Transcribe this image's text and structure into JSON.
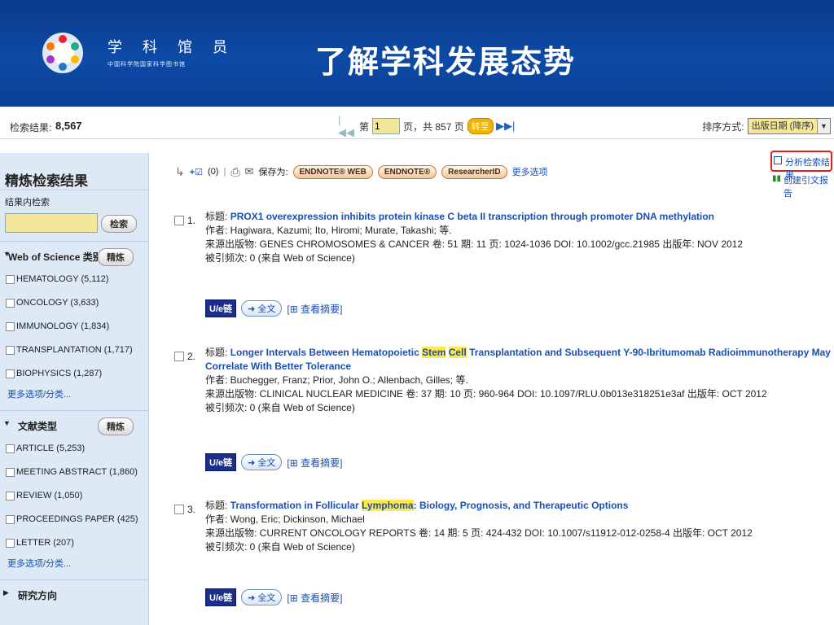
{
  "banner": {
    "brand_title": "学 科 馆 员",
    "brand_sub": "中国科学院国家科学图书馆",
    "slide_title": "了解学科发展态势"
  },
  "topbar": {
    "results_label": "检索结果:",
    "results_count": "8,567",
    "page_prefix": "第",
    "page_value": "1",
    "page_suffix": "页，共 857 页",
    "goto_label": "转至",
    "sort_label": "排序方式:",
    "sort_value": "出版日期 (降序)"
  },
  "sidebar": {
    "title": "精炼检索结果",
    "within_label": "结果内检索",
    "search_button": "检索",
    "refine_button": "精炼",
    "wos_heading": "Web of Science 类别",
    "wos_items": [
      "HEMATOLOGY (5,112)",
      "ONCOLOGY (3,633)",
      "IMMUNOLOGY (1,834)",
      "TRANSPLANTATION (1,717)",
      "BIOPHYSICS (1,287)"
    ],
    "more_label": "更多选项/分类...",
    "doc_heading": "文献类型",
    "doc_items": [
      "ARTICLE (5,253)",
      "MEETING ABSTRACT (1,860)",
      "REVIEW (1,050)",
      "PROCEEDINGS PAPER (425)",
      "LETTER (207)"
    ],
    "dir_heading": "研究方向"
  },
  "toolbar": {
    "marked_count": "(0)",
    "save_label": "保存为:",
    "endnote_web": "ENDNOTE® WEB",
    "endnote": "ENDNOTE®",
    "researcherid": "ResearcherID",
    "more_options": "更多选项",
    "analyze": "分析检索结果",
    "citation_report": "创建引文报告"
  },
  "results": [
    {
      "num": "1.",
      "title_label": "标题:",
      "title_pre": "PROX1 overexpression inhibits protein kinase C beta II transcription through promoter DNA methylation",
      "title_hl1": "",
      "title_mid": "",
      "title_hl2": "",
      "title_post": "",
      "authors": "作者: Hagiwara, Kazumi; Ito, Hiromi; Murate, Takashi; 等.",
      "source": "来源出版物: GENES CHROMOSOMES & CANCER  卷: 51  期: 11  页: 1024-1036  DOI: 10.1002/gcc.21985  出版年: NOV 2012",
      "cited": "被引频次: 0 (来自 Web of Science)"
    },
    {
      "num": "2.",
      "title_label": "标题:",
      "title_pre": "Longer Intervals Between Hematopoietic ",
      "title_hl1": "Stem",
      "title_mid": " ",
      "title_hl2": "Cell",
      "title_post": " Transplantation and Subsequent Y-90-Ibritumomab Radioimmunotherapy May Correlate With Better Tolerance",
      "authors": "作者: Buchegger, Franz; Prior, John O.; Allenbach, Gilles; 等.",
      "source": "来源出版物: CLINICAL NUCLEAR MEDICINE  卷: 37  期: 10  页: 960-964  DOI: 10.1097/RLU.0b013e318251e3af  出版年: OCT 2012",
      "cited": "被引频次: 0 (来自 Web of Science)"
    },
    {
      "num": "3.",
      "title_label": "标题:",
      "title_pre": "Transformation in Follicular ",
      "title_hl1": "Lymphoma",
      "title_mid": "",
      "title_hl2": "",
      "title_post": ": Biology, Prognosis, and Therapeutic Options",
      "authors": "作者: Wong, Eric; Dickinson, Michael",
      "source": "来源出版物: CURRENT ONCOLOGY REPORTS  卷: 14  期: 5  页: 424-432  DOI: 10.1007/s11912-012-0258-4  出版年: OCT 2012",
      "cited": "被引频次: 0 (来自 Web of Science)"
    }
  ],
  "result_links": {
    "ulink": "U/e链",
    "fulltext": "➜ 全文",
    "abstract": "[⊞ 查看摘要]"
  }
}
